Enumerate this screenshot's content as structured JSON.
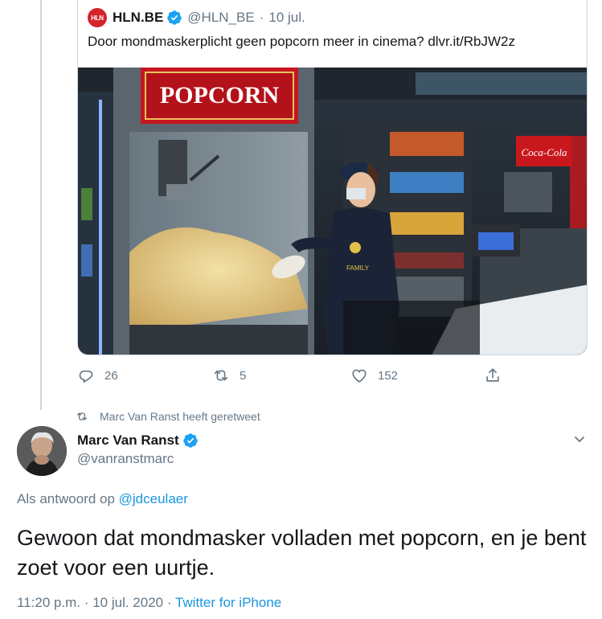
{
  "quoted_tweet": {
    "logo_text": "HLN",
    "author_name": "HLN.BE",
    "author_handle": "@HLN_BE",
    "separator": "·",
    "date": "10 jul.",
    "text": "Door mondmaskerplicht geen popcorn meer in cinema? dlvr.it/RbJW2z",
    "image": {
      "sign_text": "POPCORN",
      "cola_text": "Coca-Cola",
      "shirt_text": "FAMILY"
    }
  },
  "actions": {
    "replies": "26",
    "retweets": "5",
    "likes": "152"
  },
  "retweet_context": "Marc Van Ranst heeft geretweet",
  "tweet": {
    "author_name": "Marc Van Ranst",
    "author_handle": "@vanranstmarc",
    "reply_prefix": "Als antwoord op",
    "reply_target": "@jdceulaer",
    "text": "Gewoon dat mondmasker volladen met popcorn, en je bent zoet voor een uurtje.",
    "time": "11:20 p.m.",
    "date": "10 jul. 2020",
    "separator": "·",
    "source": "Twitter for iPhone"
  },
  "colors": {
    "link": "#1b95e0",
    "secondary_text": "#657786",
    "verified": "#1da1f2",
    "border": "#ccd6dd"
  },
  "icons": [
    "verified-badge-icon",
    "reply-icon",
    "retweet-icon",
    "like-icon",
    "share-icon",
    "chevron-down-icon",
    "hln-logo"
  ]
}
